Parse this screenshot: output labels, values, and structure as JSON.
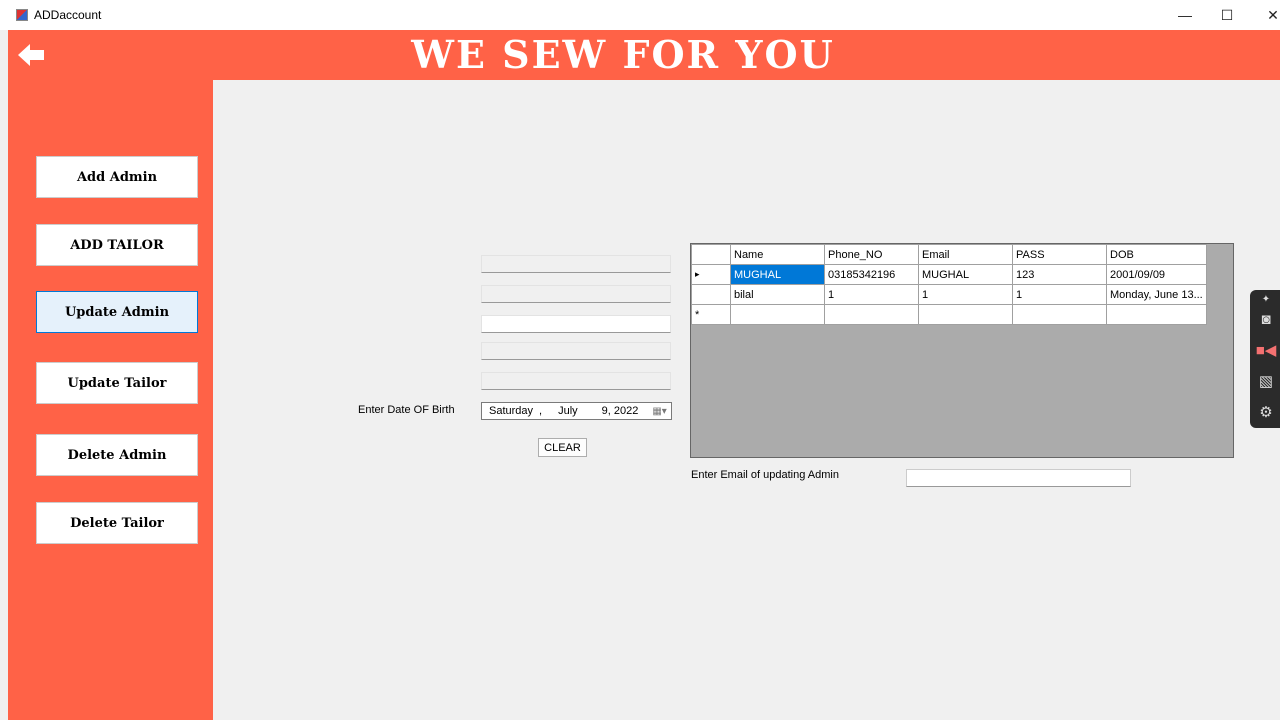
{
  "window": {
    "title": "ADDaccount",
    "minimize": "—",
    "maximize": "☐",
    "close": "✕"
  },
  "header": {
    "brand": "WE SEW FOR YOU"
  },
  "sidebar": {
    "items": [
      {
        "label": "Add Admin"
      },
      {
        "label": "ADD TAILOR"
      },
      {
        "label": "Update Admin"
      },
      {
        "label": "Update Tailor"
      },
      {
        "label": "Delete Admin"
      },
      {
        "label": "Delete Tailor"
      }
    ]
  },
  "form": {
    "dob_label": "Enter Date OF Birth",
    "dob": {
      "weekday": "Saturday",
      "sep": ",",
      "month": "July",
      "day_year": "9, 2022"
    },
    "clear_label": "CLEAR",
    "email_label": "Enter Email of updating Admin",
    "email_value": ""
  },
  "grid": {
    "columns": [
      "Name",
      "Phone_NO",
      "Email",
      "PASS",
      "DOB"
    ],
    "rows": [
      [
        "MUGHAL",
        "03185342196",
        "MUGHAL",
        "123",
        "2001/09/09"
      ],
      [
        "bilal",
        "1",
        "1",
        "1",
        "Monday, June 13..."
      ]
    ],
    "current_marker": "▸",
    "new_marker": "*"
  }
}
